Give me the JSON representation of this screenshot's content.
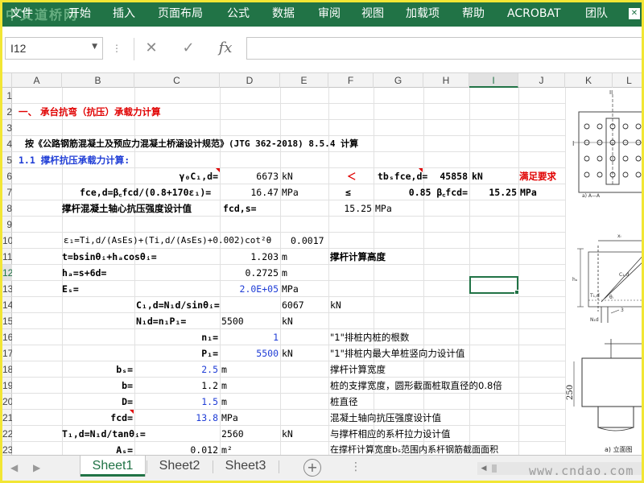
{
  "app": {
    "watermark_top": "中文道桥网",
    "watermark_bottom": "www.cndao.com",
    "accent": "#217346"
  },
  "ribbon": {
    "tabs": [
      {
        "label": "文件"
      },
      {
        "label": "开始"
      },
      {
        "label": "插入"
      },
      {
        "label": "页面布局"
      },
      {
        "label": "公式"
      },
      {
        "label": "数据"
      },
      {
        "label": "审阅"
      },
      {
        "label": "视图"
      },
      {
        "label": "加载项"
      },
      {
        "label": "帮助"
      },
      {
        "label": "ACROBAT"
      },
      {
        "label": "团队"
      }
    ],
    "close_glyph": "✕"
  },
  "formula_bar": {
    "name_box": "I12",
    "cancel_glyph": "✕",
    "enter_glyph": "✓",
    "fx_label": "fx",
    "formula": ""
  },
  "columns": [
    "A",
    "B",
    "C",
    "D",
    "E",
    "F",
    "G",
    "H",
    "I",
    "J",
    "K",
    "L"
  ],
  "rows": [
    "1",
    "2",
    "3",
    "4",
    "5",
    "6",
    "7",
    "8",
    "9",
    "10",
    "11",
    "12",
    "13",
    "14",
    "15",
    "16",
    "17",
    "18",
    "19",
    "20",
    "21",
    "22",
    "23"
  ],
  "selected": {
    "column": "I",
    "row": "12"
  },
  "cells": {
    "r2_a": "一、 承台抗弯（抗压）承载力计算",
    "r4_a": "按《公路钢筋混凝土及预应力混凝土桥涵设计规范》(JTG 362-2018)  8.5.4 计算",
    "r5_a": "1.1  撑杆抗压承载力计算:",
    "r6_c": "γ₀C₁,d=",
    "r6_d": "6673",
    "r6_e": "kN",
    "r6_f": "＜",
    "r6_g": "tbₛfce,d=",
    "r6_h": "45858",
    "r6_i": "kN",
    "r6_j": "满足要求",
    "r7_b": "fce,d=β꜀fcd/(0.8+170ε₁)=",
    "r7_d": "16.47",
    "r7_e": "MPa",
    "r7_f": "≤",
    "r7_h": "0.85 β꜀fcd=",
    "r7_i": "15.25",
    "r7_j": "MPa",
    "r8_b": "撑杆混凝土轴心抗压强度设计值",
    "r8_c": "fcd,s=",
    "r8_f": "15.25",
    "r8_g": "MPa",
    "r10_b": "ε₁=Ti,d/(AsEs)+(Ti,d/(AsEs)+0.002)cot²θ",
    "r10_e": "0.0017",
    "r11_b": "t=bsinθᵢ+hₐcosθᵢ=",
    "r11_d": "1.203",
    "r11_e": "m",
    "r11_f": "撑杆计算高度",
    "r12_b": "hₐ=s+6d=",
    "r12_d": "0.2725",
    "r12_e": "m",
    "r13_b": "Eₛ=",
    "r13_d": "2.0E+05",
    "r13_e": "MPa",
    "r14_c": "C₁,d=N₁d/sinθᵢ=",
    "r14_e": "6067",
    "r14_f": "kN",
    "r15_c": "N₁d=n₁P₁=",
    "r15_d": "5500",
    "r15_e": "kN",
    "r16_c": "n₁=",
    "r16_d": "1",
    "r16_f": "\"1\"排桩内桩的根数",
    "r17_c": "P₁=",
    "r17_d": "5500",
    "r17_e": "kN",
    "r17_f": "\"1\"排桩内最大单桩竖向力设计值",
    "r18_b": "bₛ=",
    "r18_c": "2.5",
    "r18_d": "m",
    "r18_f": "撑杆计算宽度",
    "r19_b": "b=",
    "r19_c": "1.2",
    "r19_d": "m",
    "r19_f": "桩的支撑宽度，圆形截面桩取直径的0.8倍",
    "r20_b": "D=",
    "r20_c": "1.5",
    "r20_d": "m",
    "r20_f": "桩直径",
    "r21_b": "fcd=",
    "r21_c": "13.8",
    "r21_d": "MPa",
    "r21_f": "混凝土轴向抗压强度设计值",
    "r22_b": "T₁,d=N₁d/tanθᵢ=",
    "r22_d": "2560",
    "r22_e": "kN",
    "r22_f": "与撑杆相应的系杆拉力设计值",
    "r23_b": "Aₛ=",
    "r23_c": "0.012",
    "r23_d": "m²",
    "r23_f": "在撑杆计算宽度bₛ范围内系杆钢筋截面面积"
  },
  "diagram": {
    "label_ii": "II",
    "label_i": "I",
    "label_section": "a) A—A",
    "label_x": "xᵢ",
    "label_h": "hₐ",
    "label_c": "C₁,d",
    "label_t": "T₁,d",
    "label_theta": "θᵢ",
    "label_n": "N₁d",
    "label_3": "3",
    "label_250": "250",
    "label_elevation": "a) 立面图"
  },
  "sheet_tabs": {
    "tabs": [
      {
        "label": "Sheet1",
        "active": true
      },
      {
        "label": "Sheet2",
        "active": false
      },
      {
        "label": "Sheet3",
        "active": false
      }
    ],
    "add_glyph": "+",
    "more_glyph": "⋮",
    "nav_prev": "◀",
    "nav_next": "▶"
  }
}
